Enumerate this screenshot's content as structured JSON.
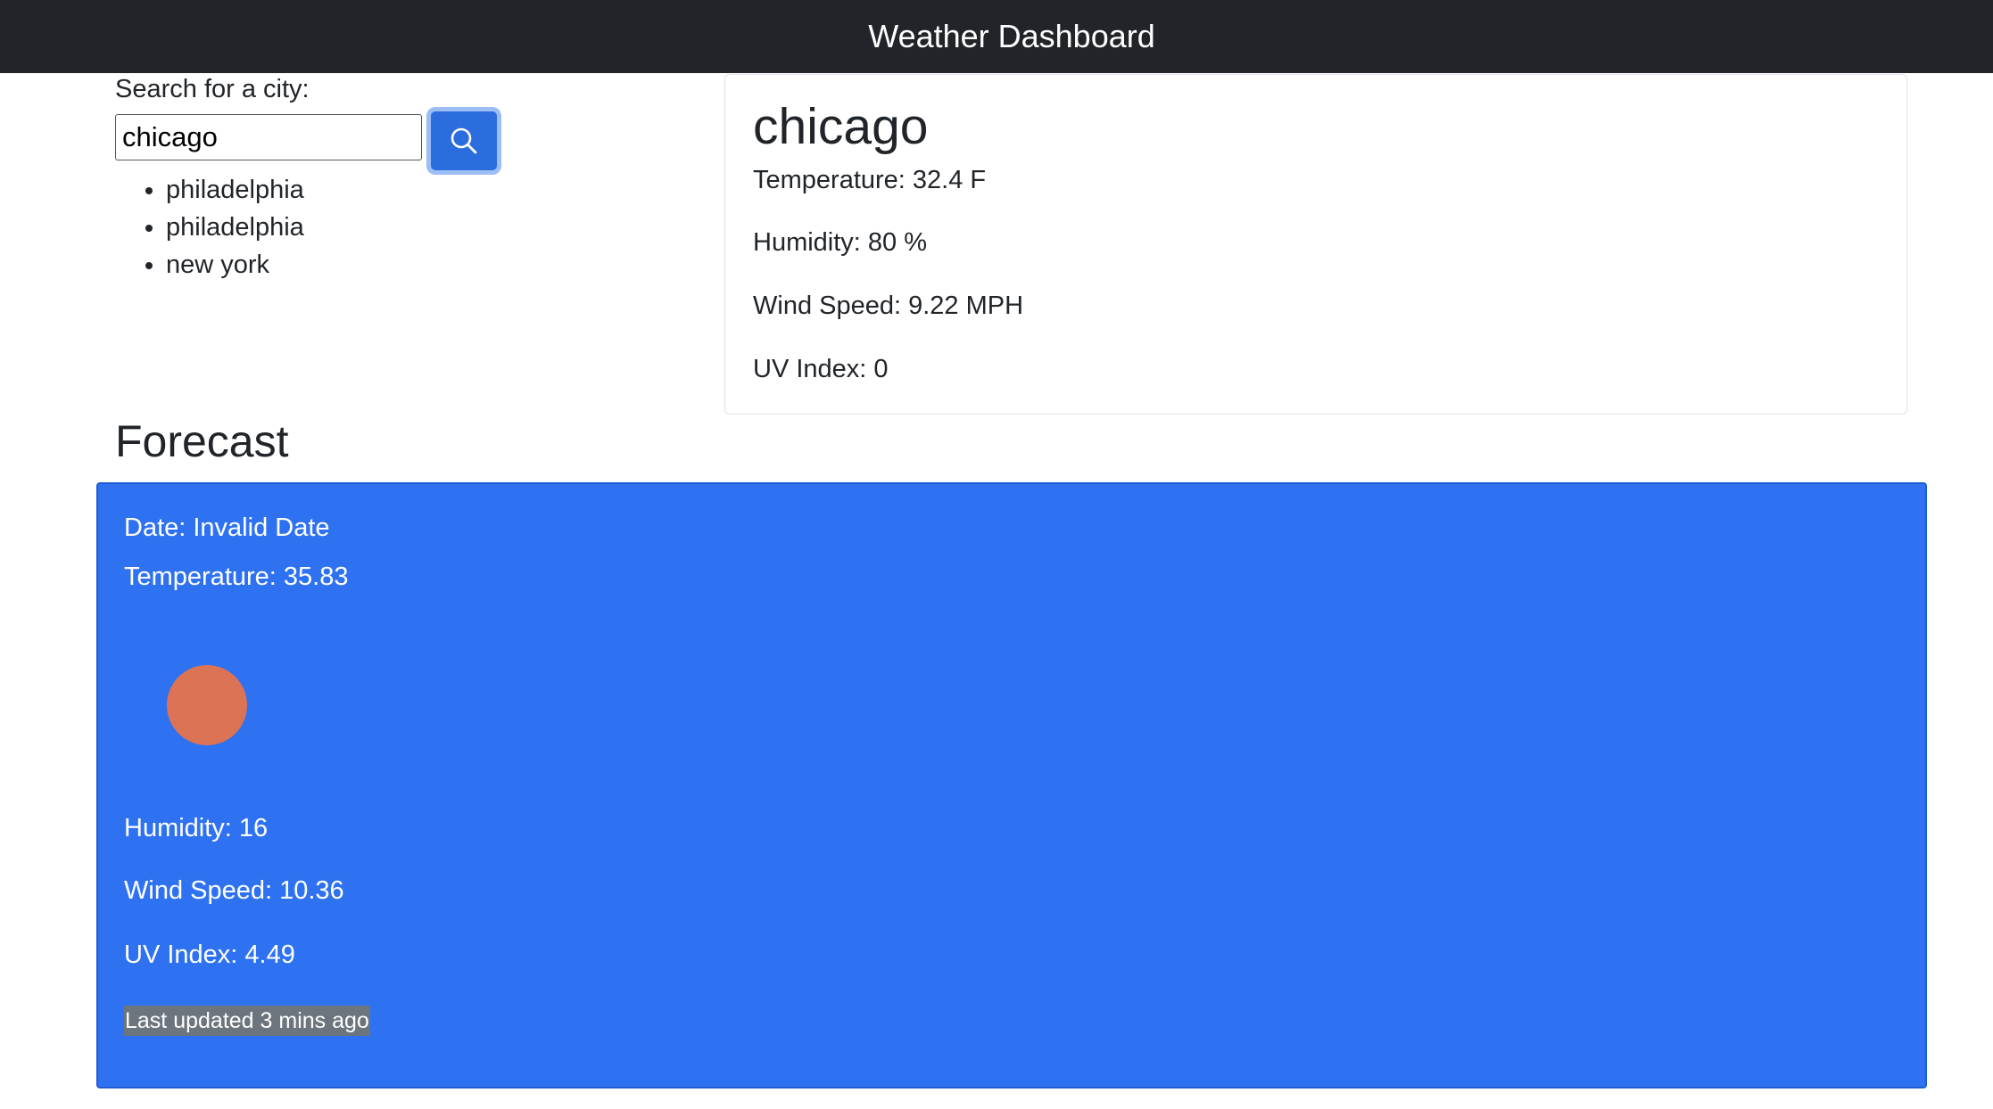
{
  "navbar": {
    "title": "Weather Dashboard"
  },
  "search": {
    "label": "Search for a city:",
    "value": "chicago",
    "button_icon": "search-icon"
  },
  "history": [
    "philadelphia",
    "philadelphia",
    "new york"
  ],
  "current": {
    "city": "chicago",
    "temperature": "Temperature: 32.4 F",
    "humidity": "Humidity: 80 %",
    "wind": "Wind Speed: 9.22 MPH",
    "uv": "UV Index: 0"
  },
  "forecast": {
    "heading": "Forecast",
    "card_color": "#2e72f2",
    "date": "Date: Invalid Date",
    "temperature": "Temperature: 35.83",
    "icon": "weather-icon",
    "humidity": "Humidity: 16",
    "wind": "Wind Speed: 10.36",
    "uv": "UV Index: 4.49",
    "updated": "Last updated 3 mins ago"
  }
}
